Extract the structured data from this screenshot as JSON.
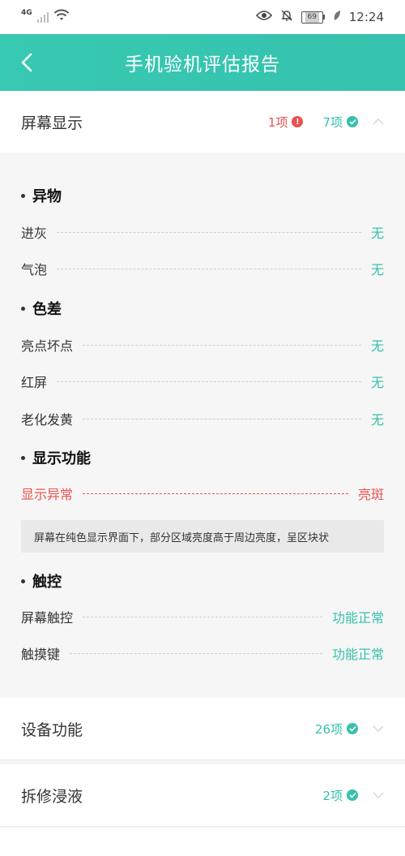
{
  "status_bar": {
    "network": "4G",
    "battery": "69",
    "time": "12:24"
  },
  "header": {
    "title": "手机验机评估报告"
  },
  "sections": [
    {
      "title": "屏幕显示",
      "bad_count": "1项",
      "ok_count": "7项",
      "expanded": true
    },
    {
      "title": "设备功能",
      "ok_count": "26项",
      "expanded": false
    },
    {
      "title": "拆修浸液",
      "ok_count": "2项",
      "expanded": false
    }
  ],
  "detail": {
    "groups": [
      {
        "title": "异物",
        "items": [
          {
            "label": "进灰",
            "value": "无"
          },
          {
            "label": "气泡",
            "value": "无"
          }
        ]
      },
      {
        "title": "色差",
        "items": [
          {
            "label": "亮点坏点",
            "value": "无"
          },
          {
            "label": "红屏",
            "value": "无"
          },
          {
            "label": "老化发黄",
            "value": "无"
          }
        ]
      },
      {
        "title": "显示功能",
        "items": [
          {
            "label": "显示异常",
            "value": "亮斑",
            "status": "bad"
          }
        ],
        "note": "屏幕在纯色显示界面下，部分区域亮度高于周边亮度，呈区块状"
      },
      {
        "title": "触控",
        "items": [
          {
            "label": "屏幕触控",
            "value": "功能正常"
          },
          {
            "label": "触摸键",
            "value": "功能正常"
          }
        ]
      }
    ]
  },
  "colors": {
    "accent": "#35c1ab",
    "error": "#e9524f"
  },
  "icons": [
    "eye-icon",
    "bell-off-icon",
    "leaf-icon",
    "back-arrow-icon",
    "alert-icon",
    "check-icon",
    "chevron-up-icon",
    "chevron-down-icon"
  ]
}
